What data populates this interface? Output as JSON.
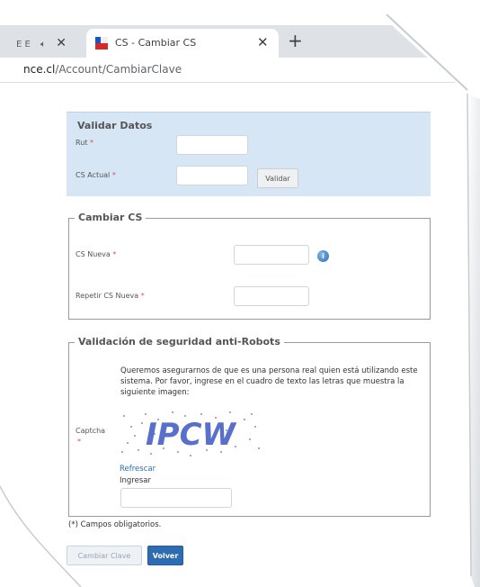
{
  "browser": {
    "prev_tab_fragment": "E E",
    "active_tab_title": "CS - Cambiar CS",
    "new_tab_symbol": "+",
    "url_host": "nce.cl",
    "url_path": "/Account/CambiarClave"
  },
  "validar_datos": {
    "legend": "Validar Datos",
    "rut_label": "Rut",
    "cs_actual_label": "CS Actual",
    "required_mark": "*",
    "validar_button": "Validar",
    "rut_value": "",
    "cs_actual_value": ""
  },
  "cambiar_cs": {
    "legend": "Cambiar CS",
    "cs_nueva_label": "CS Nueva",
    "repetir_label": "Repetir CS Nueva",
    "required_mark": "*",
    "info_icon": "info-icon",
    "cs_nueva_value": "",
    "repetir_value": ""
  },
  "captcha": {
    "legend": "Validación de seguridad anti-Robots",
    "instructions": "Queremos asegurarnos de que es una persona real quien está utilizando este sistema. Por favor, ingrese en el cuadro de texto las letras que muestra la siguiente imagen:",
    "label": "Captcha",
    "required_mark": "*",
    "image_text": "IPCW",
    "refresh_link": "Refrescar",
    "input_label": "Ingresar",
    "input_value": ""
  },
  "footer": {
    "required_note": "(*) Campos obligatorios.",
    "cambiar_button": "Cambiar Clave",
    "volver_button": "Volver"
  },
  "colors": {
    "accent": "#2d6cb0",
    "panel_blue": "#d6e6f5",
    "required": "#d9534f"
  }
}
